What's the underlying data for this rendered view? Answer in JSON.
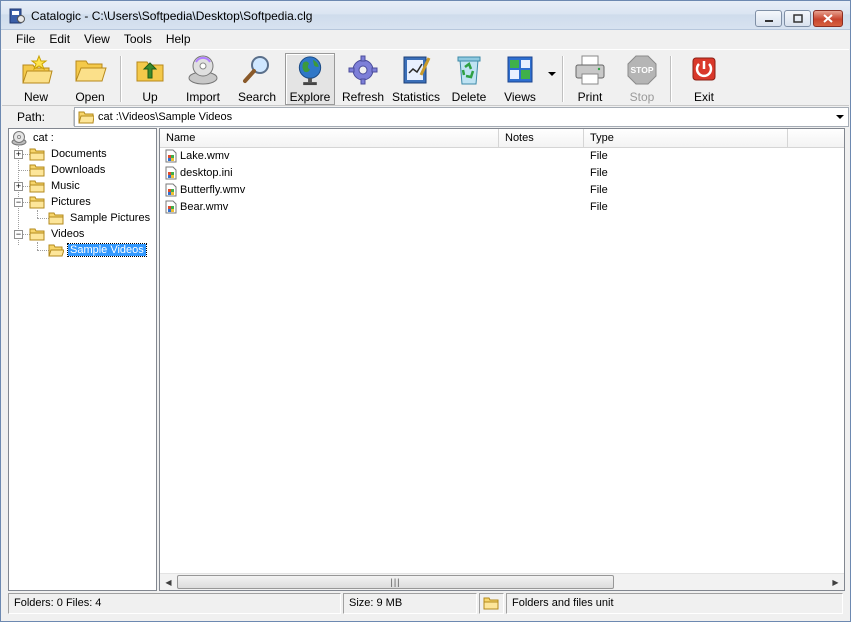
{
  "window": {
    "title": "Catalogic - C:\\Users\\Softpedia\\Desktop\\Softpedia.clg"
  },
  "menu": [
    "File",
    "Edit",
    "View",
    "Tools",
    "Help"
  ],
  "toolbar": {
    "new": "New",
    "open": "Open",
    "up": "Up",
    "import": "Import",
    "search": "Search",
    "explore": "Explore",
    "refresh": "Refresh",
    "statistics": "Statistics",
    "delete": "Delete",
    "views": "Views",
    "print": "Print",
    "stop": "Stop",
    "stop_icon_text": "STOP",
    "exit": "Exit"
  },
  "pathbar": {
    "label": "Path:",
    "value": "cat :\\Videos\\Sample Videos"
  },
  "tree": {
    "root": "cat :",
    "items": [
      {
        "label": "Documents"
      },
      {
        "label": "Downloads"
      },
      {
        "label": "Music"
      },
      {
        "label": "Pictures"
      },
      {
        "label": "Sample Pictures"
      },
      {
        "label": "Videos"
      },
      {
        "label": "Sample Videos"
      }
    ]
  },
  "list": {
    "columns": [
      "Name",
      "Notes",
      "Type"
    ],
    "rows": [
      {
        "name": "Lake.wmv",
        "notes": "",
        "type": "File"
      },
      {
        "name": "desktop.ini",
        "notes": "",
        "type": "File"
      },
      {
        "name": "Butterfly.wmv",
        "notes": "",
        "type": "File"
      },
      {
        "name": "Bear.wmv",
        "notes": "",
        "type": "File"
      }
    ]
  },
  "status": {
    "counts": "Folders: 0  Files: 4",
    "size": "Size: 9 MB",
    "unit": "Folders and files unit"
  }
}
